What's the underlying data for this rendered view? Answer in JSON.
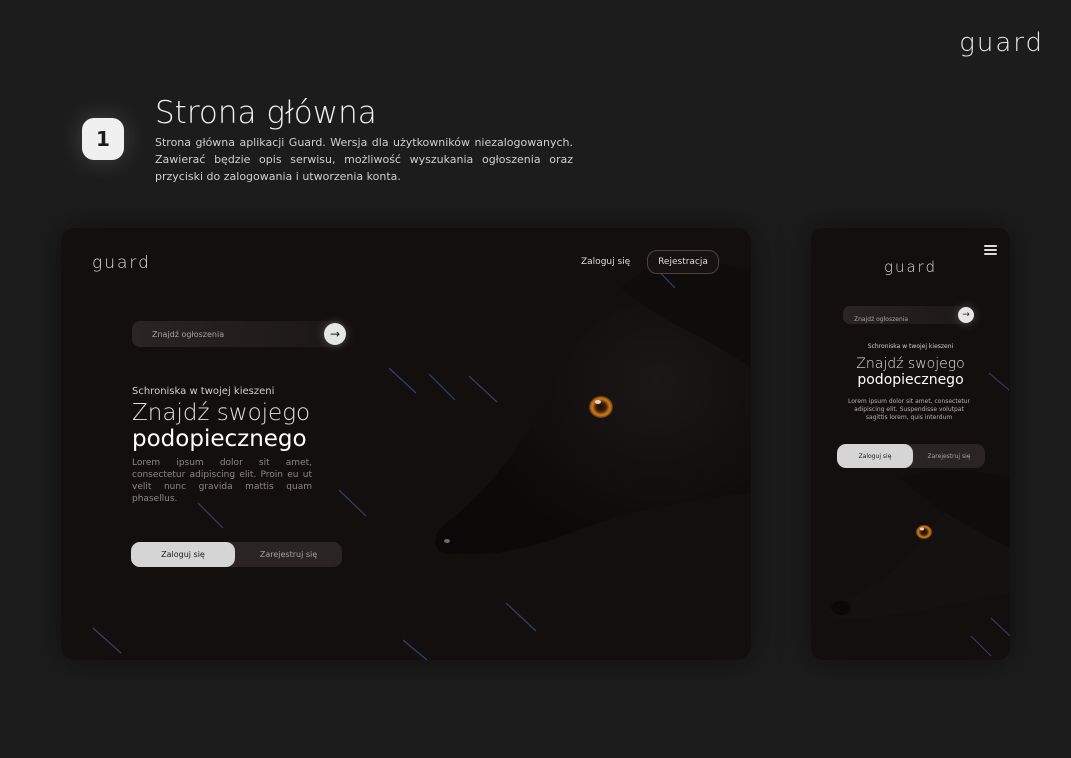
{
  "brand": {
    "logo": "guard"
  },
  "section": {
    "number": "1",
    "title": "Strona główna",
    "description": "Strona główna aplikacji Guard. Wersja dla użytkowników niezalogowanych. Zawierać będzie opis serwisu, możliwość wyszukania ogłoszenia oraz przyciski do zalogowania i utworzenia konta."
  },
  "desktop": {
    "logo": "guard",
    "nav": {
      "login": "Zaloguj się",
      "register": "Rejestracja"
    },
    "search": {
      "placeholder": "Znajdź ogłoszenia"
    },
    "hero": {
      "eyebrow": "Schroniska w twojej kieszeni",
      "headline_light": "Znajdź swojego",
      "headline_bold": "podopiecznego",
      "body": "Lorem ipsum dolor sit amet, consectetur adipiscing elit. Proin eu ut velit nunc gravida mattis quam phasellus."
    },
    "buttons": {
      "login": "Zaloguj się",
      "signup": "Zarejestruj się"
    }
  },
  "mobile": {
    "logo": "guard",
    "search": {
      "placeholder": "Znajdź ogłoszenia"
    },
    "hero": {
      "eyebrow": "Schroniska w twojej kieszeni",
      "headline_light": "Znajdź swojego",
      "headline_bold": "podopiecznego",
      "body": "Lorem ipsum dolor sit amet, consectetur adipiscing elit. Suspendisse volutpat sagittis lorem, quis interdum"
    },
    "buttons": {
      "login": "Zaloguj się",
      "signup": "Zarejestruj się"
    }
  },
  "icons": {
    "arrow": "arrow-right-icon",
    "menu": "hamburger-menu-icon",
    "dog": "dog-photo"
  },
  "colors": {
    "background": "#1c1c1c",
    "frame": "#140f0f",
    "accent_eye": "#e08a1e",
    "streak": "#3c4a78"
  }
}
